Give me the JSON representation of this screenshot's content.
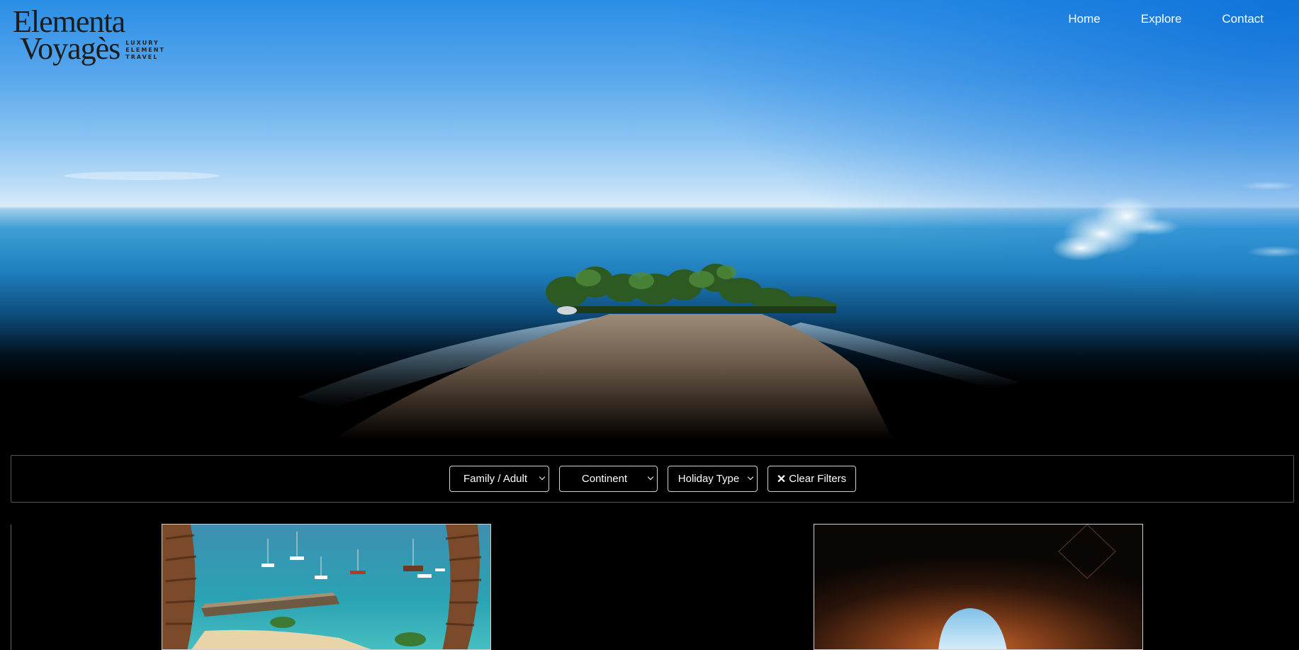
{
  "brand": {
    "line1": "Elementa",
    "line2": "Voyagès",
    "tagline": [
      "LUXURY",
      "ELEMENT",
      "TRAVEL"
    ]
  },
  "nav": {
    "items": [
      {
        "label": "Home"
      },
      {
        "label": "Explore"
      },
      {
        "label": "Contact"
      }
    ]
  },
  "filters": {
    "audience": "Family / Adult",
    "continent": "Continent",
    "holiday_type": "Holiday Type",
    "clear_label": "Clear Filters",
    "clear_icon": "close-icon"
  },
  "cards": [
    {
      "image": "beach-bay-palms-boats"
    },
    {
      "image": "sea-cave-arch"
    }
  ],
  "colors": {
    "background": "#000000",
    "border": "#d0d0d0",
    "sky": "#2a8ee6",
    "sea": "#1f7fbe"
  }
}
